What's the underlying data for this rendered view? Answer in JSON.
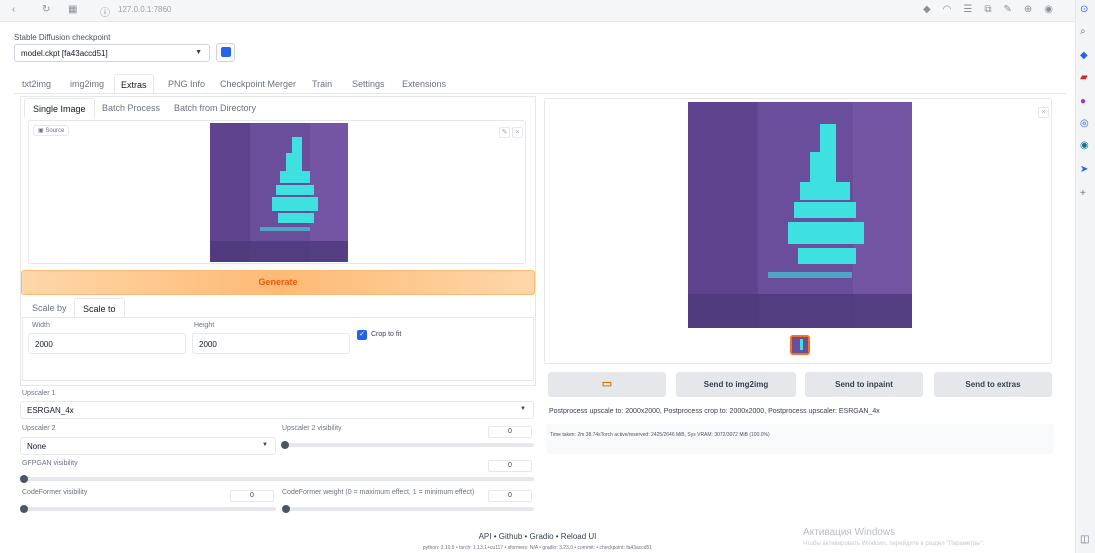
{
  "browser": {
    "url": "127.0.0.1:7860"
  },
  "checkpoint": {
    "label": "Stable Diffusion checkpoint",
    "value": "model.ckpt [fa43accd51]"
  },
  "tabs": [
    "txt2img",
    "img2img",
    "Extras",
    "PNG Info",
    "Checkpoint Merger",
    "Train",
    "Settings",
    "Extensions"
  ],
  "active_tab": "Extras",
  "subtabs": [
    "Single Image",
    "Batch Process",
    "Batch from Directory"
  ],
  "source_label": "Source",
  "generate_label": "Generate",
  "scale_tabs": [
    "Scale by",
    "Scale to"
  ],
  "scale": {
    "width_label": "Width",
    "width_value": "2000",
    "height_label": "Height",
    "height_value": "2000",
    "crop_label": "Crop to fit",
    "crop_checked": true
  },
  "upscaler1": {
    "label": "Upscaler 1",
    "value": "ESRGAN_4x"
  },
  "upscaler2": {
    "label": "Upscaler 2",
    "value": "None"
  },
  "upscaler2_visibility": {
    "label": "Upscaler 2 visibility",
    "value": "0"
  },
  "gfpgan": {
    "label": "GFPGAN visibility",
    "value": "0"
  },
  "codeformer_visibility": {
    "label": "CodeFormer visibility",
    "value": "0"
  },
  "codeformer_weight": {
    "label": "CodeFormer weight (0 = maximum effect, 1 = minimum effect)",
    "value": "0"
  },
  "output_buttons": [
    "Send to img2img",
    "Send to inpaint",
    "Send to extras"
  ],
  "output_info": "Postprocess upscale to: 2000x2000, Postprocess crop to: 2000x2000, Postprocess upscaler: ESRGAN_4x",
  "time_info": "Time taken: 2m 38.74sTorch active/reserved: 2425/2646 MiB, Sys VRAM: 3072/3072 MiB (100.0%)",
  "footer": {
    "links": "API  •  Github  •  Gradio  •  Reload UI",
    "version": "python: 3.10.5  •  torch: 1.13.1+cu117  •  xformers: N/A  •  gradio: 3.23.0  •  commit:  •  checkpoint: fa43accd51"
  },
  "watermark": {
    "title": "Активация Windows",
    "subtitle": "Чтобы активировать Windows, перейдите в раздел \"Параметры\"."
  },
  "colors": {
    "accent": "#2563eb",
    "generate_bg": "#fdba74",
    "generate_text": "#ea580c",
    "art_purple": "#6b4e9b",
    "art_cyan": "#3ee0e0"
  }
}
